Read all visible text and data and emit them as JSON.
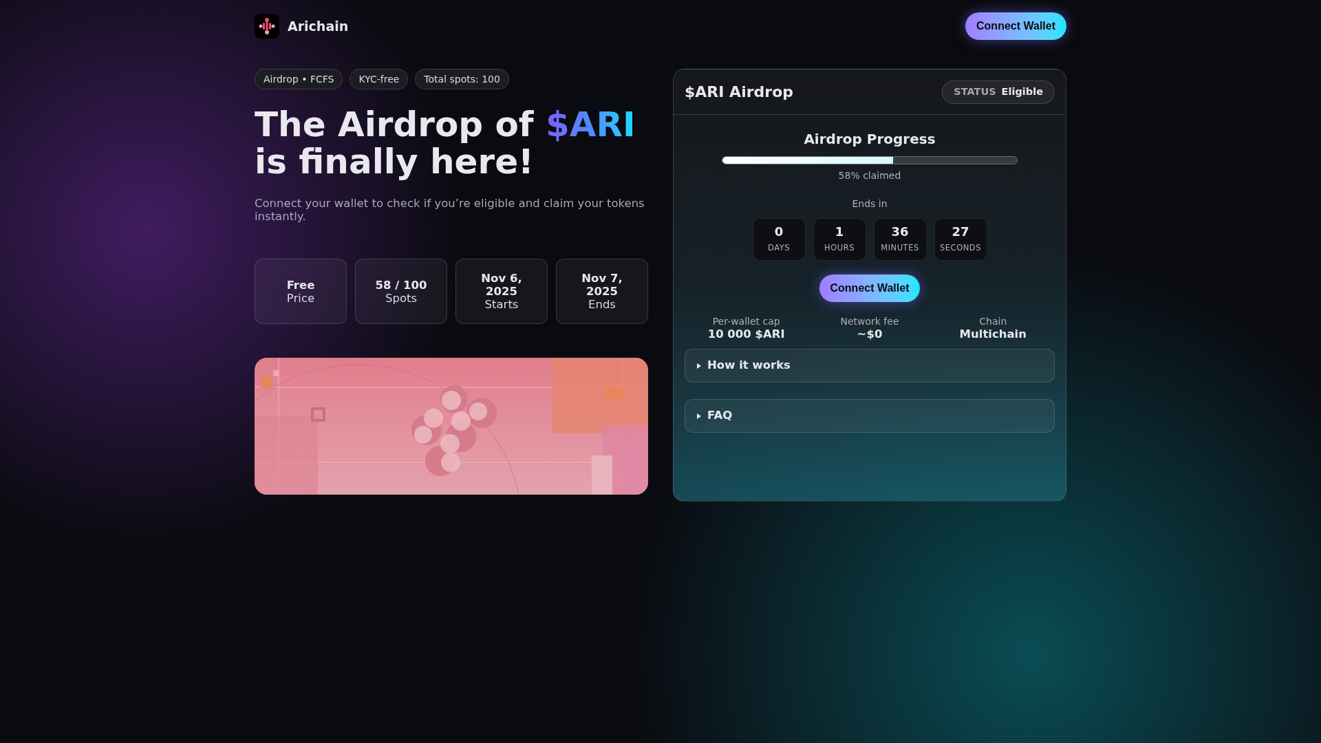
{
  "brand": {
    "name": "Arichain"
  },
  "header_button": "Connect Wallet",
  "tags": [
    "Airdrop • FCFS",
    "KYC-free",
    "Total spots: 100"
  ],
  "headline": {
    "before": "The Airdrop of",
    "highlight": "$ARI",
    "after": "is finally here!"
  },
  "subtitle": "Connect your wallet to check if you’re eligible and claim your tokens instantly.",
  "stats": [
    {
      "value": "Free",
      "label": "Price"
    },
    {
      "value": "58 / 100",
      "label": "Spots"
    },
    {
      "value": "Nov 6, 2025",
      "label": "Starts"
    },
    {
      "value": "Nov 7, 2025",
      "label": "Ends"
    }
  ],
  "card": {
    "title": "$ARI Airdrop",
    "status": {
      "label": "STATUS",
      "value": "Eligible"
    },
    "progress": {
      "title": "Airdrop Progress",
      "level": 0.58,
      "reading": "58% claimed"
    },
    "countdown": {
      "label": "Ends in",
      "units": [
        {
          "value": "0",
          "label": "DAYS"
        },
        {
          "value": "1",
          "label": "HOURS"
        },
        {
          "value": "36",
          "label": "MINUTES"
        },
        {
          "value": "27",
          "label": "SECONDS"
        }
      ]
    },
    "button": "Connect Wallet",
    "details": [
      {
        "label": "Per-wallet cap",
        "value": "10 000 $ARI"
      },
      {
        "label": "Network fee",
        "value": "~$0"
      },
      {
        "label": "Chain",
        "value": "Multichain"
      }
    ],
    "sections": [
      {
        "label": "How it works",
        "expanded": false
      },
      {
        "label": "FAQ",
        "expanded": false
      }
    ]
  }
}
